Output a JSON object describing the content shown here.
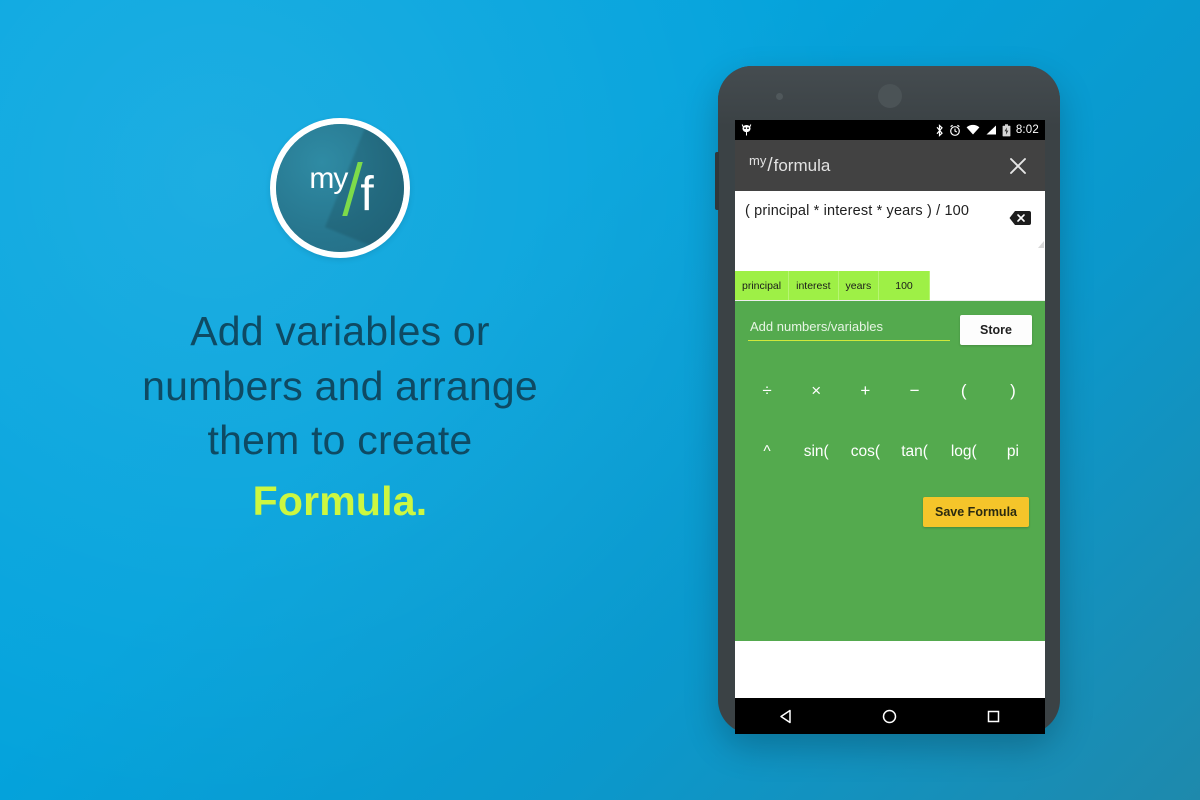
{
  "promo": {
    "logo": {
      "my": "my",
      "slash": "/",
      "f": "f",
      "name": "myformula-logo"
    },
    "headline_line1": "Add variables or",
    "headline_line2": "numbers and arrange",
    "headline_line3": "them to create",
    "headline_accent": "Formula.",
    "colors": {
      "background_start": "#04a6e0",
      "background_end": "#1e89ac",
      "headline_text": "#0e4a63",
      "accent_text": "#ccf741",
      "logo_slash": "#7ddb4a",
      "logo_fill": "#27768e"
    }
  },
  "phone": {
    "statusbar": {
      "notification_icon": "android-notification-icon",
      "bluetooth_icon": "bluetooth-icon",
      "alarm_icon": "alarm-clock-icon",
      "wifi_icon": "wifi-icon",
      "signal_icon": "cellular-signal-icon",
      "battery_icon": "battery-charging-icon",
      "time": "8:02"
    },
    "appbar": {
      "title_my": "my",
      "title_slash": "/",
      "title_formula": "formula",
      "close_icon": "close-icon",
      "background": "#424242"
    },
    "formula_display": {
      "expression": "( principal * interest * years )  / 100",
      "clear_icon": "backspace-clear-icon"
    },
    "chips": [
      {
        "label": "principal"
      },
      {
        "label": "interest"
      },
      {
        "label": "years"
      },
      {
        "label": "100"
      }
    ],
    "keypad": {
      "background": "#54aa4e",
      "input_placeholder": "Add numbers/variables",
      "input_value": "",
      "store_label": "Store",
      "operators_row1": [
        "÷",
        "×",
        "+",
        "−",
        "(",
        ")"
      ],
      "operators_row2": [
        "^",
        "sin(",
        "cos(",
        "tan(",
        "log(",
        "pi"
      ],
      "save_label": "Save Formula",
      "save_color": "#f5c52a"
    },
    "navbar": {
      "back_icon": "back-triangle-icon",
      "home_icon": "home-circle-icon",
      "recents_icon": "recents-square-icon"
    }
  }
}
